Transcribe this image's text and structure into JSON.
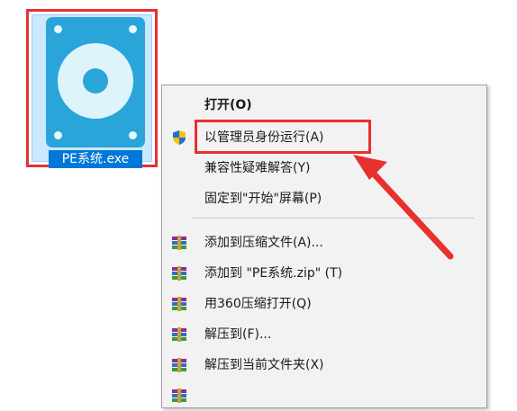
{
  "file": {
    "name": "PE系统.exe",
    "icon": "hard-disk-icon"
  },
  "context_menu": {
    "items": [
      {
        "label": "打开(O)",
        "bold": true,
        "icon": ""
      },
      {
        "label": "以管理员身份运行(A)",
        "icon": "uac-shield-icon"
      },
      {
        "label": "兼容性疑难解答(Y)",
        "icon": ""
      },
      {
        "label": "固定到\"开始\"屏幕(P)",
        "icon": ""
      },
      {
        "label": "添加到压缩文件(A)...",
        "icon": "winrar-archive-icon"
      },
      {
        "label": "添加到 \"PE系统.zip\" (T)",
        "icon": "winrar-archive-icon"
      },
      {
        "label": "用360压缩打开(Q)",
        "icon": "winrar-archive-icon"
      },
      {
        "label": "解压到(F)...",
        "icon": "winrar-archive-icon"
      },
      {
        "label": "解压到当前文件夹(X)",
        "icon": "winrar-archive-icon"
      }
    ]
  },
  "annotation": {
    "highlight_color": "#e8302e",
    "highlighted_item": "以管理员身份运行(A)"
  }
}
